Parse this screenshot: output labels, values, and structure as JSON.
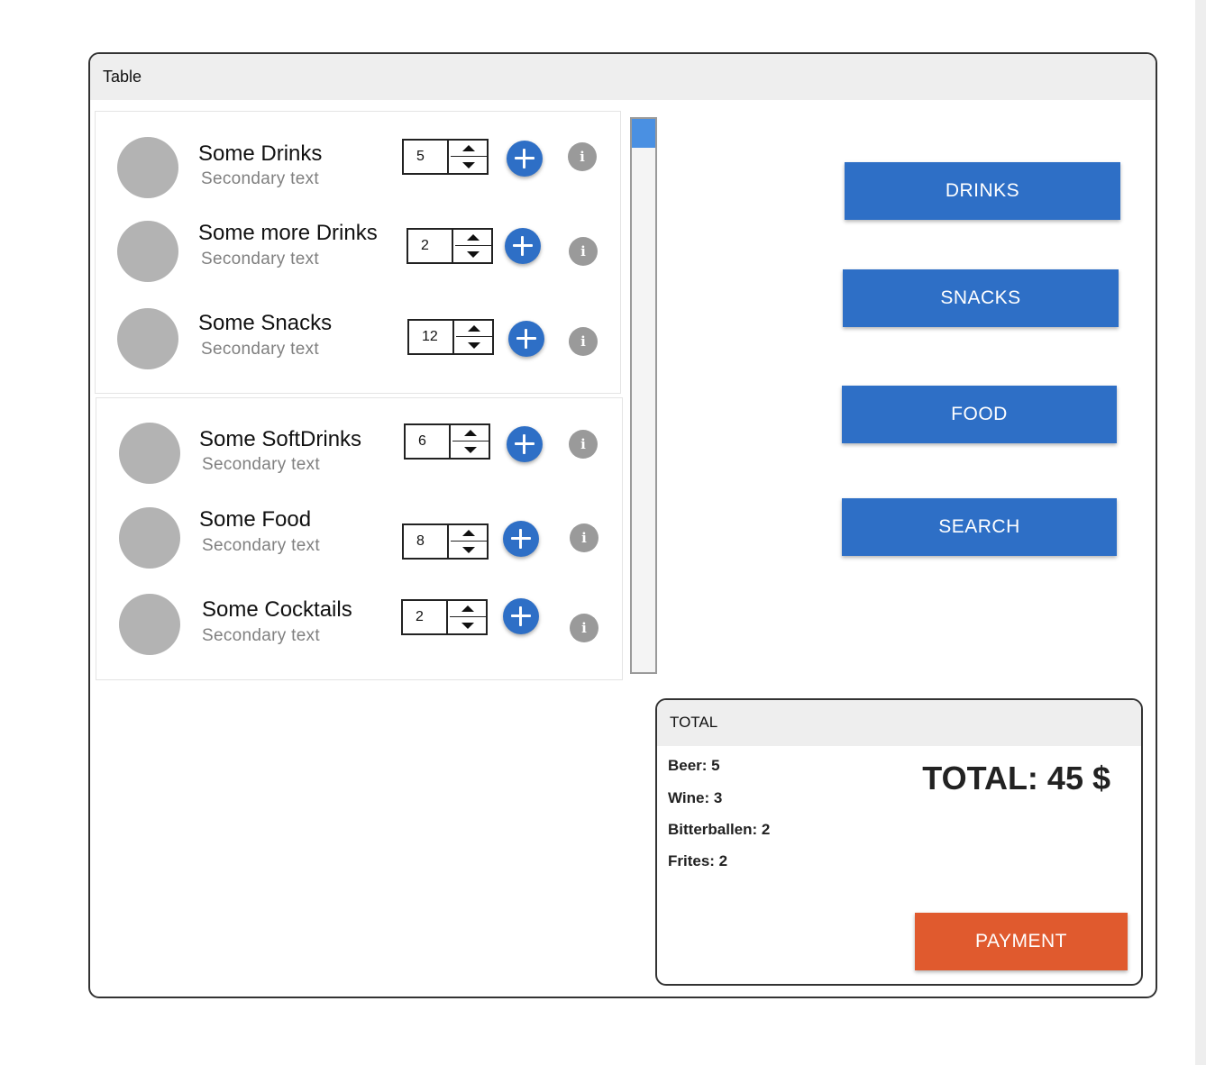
{
  "window": {
    "title": "Table"
  },
  "groups": [
    {
      "items": [
        {
          "primary": "Some Drinks",
          "secondary": "Secondary text",
          "quantity": "5"
        },
        {
          "primary": "Some more Drinks",
          "secondary": "Secondary text",
          "quantity": "2"
        },
        {
          "primary": "Some Snacks",
          "secondary": "Secondary text",
          "quantity": "12"
        }
      ]
    },
    {
      "items": [
        {
          "primary": "Some SoftDrinks",
          "secondary": "Secondary text",
          "quantity": "6"
        },
        {
          "primary": "Some Food",
          "secondary": "Secondary text",
          "quantity": "8"
        },
        {
          "primary": "Some Cocktails",
          "secondary": "Secondary text",
          "quantity": "2"
        }
      ]
    }
  ],
  "info_glyph": "i",
  "categories": {
    "drinks": "DRINKS",
    "snacks": "SNACKS",
    "food": "FOOD",
    "search": "SEARCH"
  },
  "total_panel": {
    "header": "TOTAL",
    "order_lines": [
      "Beer: 5",
      "Wine: 3",
      "Bitterballen: 2",
      "Frites: 2"
    ],
    "total_text": "TOTAL: 45 $",
    "payment_label": "PAYMENT"
  },
  "colors": {
    "primary_blue": "#2e6fc6",
    "payment_orange": "#e05a2e",
    "avatar_gray": "#b3b3b3",
    "info_gray": "#9a9a9a",
    "header_gray": "#eeeeee",
    "scroll_thumb": "#4a90e2"
  },
  "icons": {
    "add": "plus-circle-icon",
    "info": "info-circle-icon",
    "increment": "caret-up-icon",
    "decrement": "caret-down-icon"
  }
}
